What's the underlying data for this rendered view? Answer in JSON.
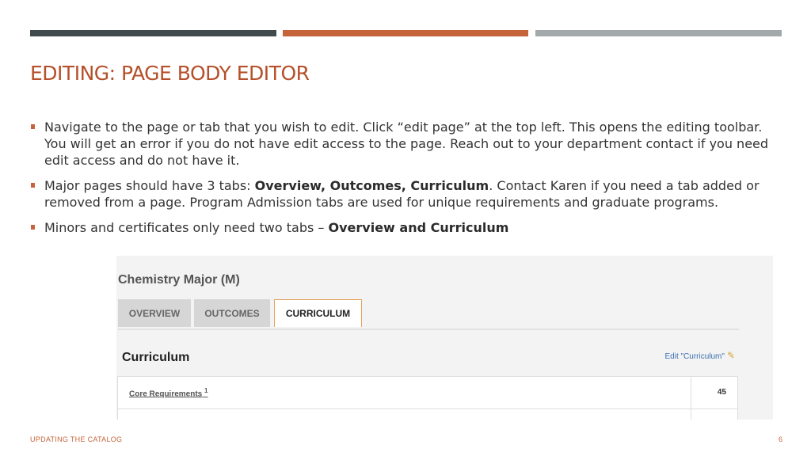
{
  "colors": {
    "bar_dark": "#414a4c",
    "bar_orange": "#c5643a",
    "bar_gray": "#a3a9ab",
    "title": "#b5502a",
    "accent": "#c5643a"
  },
  "slide": {
    "title": "EDITING: PAGE BODY EDITOR",
    "bullets": [
      {
        "text": "Navigate to the page or tab that you wish to edit.   Click “edit page” at the top left. This opens the editing toolbar. You will get an error if you do not have edit access to the page.  Reach out to your department contact if you need edit access and do not have it."
      },
      {
        "pre": "Major pages should have 3 tabs:  ",
        "bold": "Overview, Outcomes, Curriculum",
        "post": ".  Contact Karen if you need a tab added or removed from a page. Program Admission tabs are used for unique requirements and graduate programs."
      },
      {
        "pre": "Minors and certificates only need two tabs – ",
        "bold": "Overview and Curriculum"
      }
    ],
    "footer": "UPDATING THE CATALOG",
    "page_number": "6"
  },
  "screenshot": {
    "page_title": "Chemistry Major (M)",
    "tabs": [
      "OVERVIEW",
      "OUTCOMES",
      "CURRICULUM"
    ],
    "section_heading": "Curriculum",
    "edit_link": "Edit \"Curriculum\"",
    "edit_icon": "pencil-icon",
    "table_rows": [
      {
        "name": "Core Requirements",
        "sup": "1",
        "value": "45"
      }
    ]
  }
}
